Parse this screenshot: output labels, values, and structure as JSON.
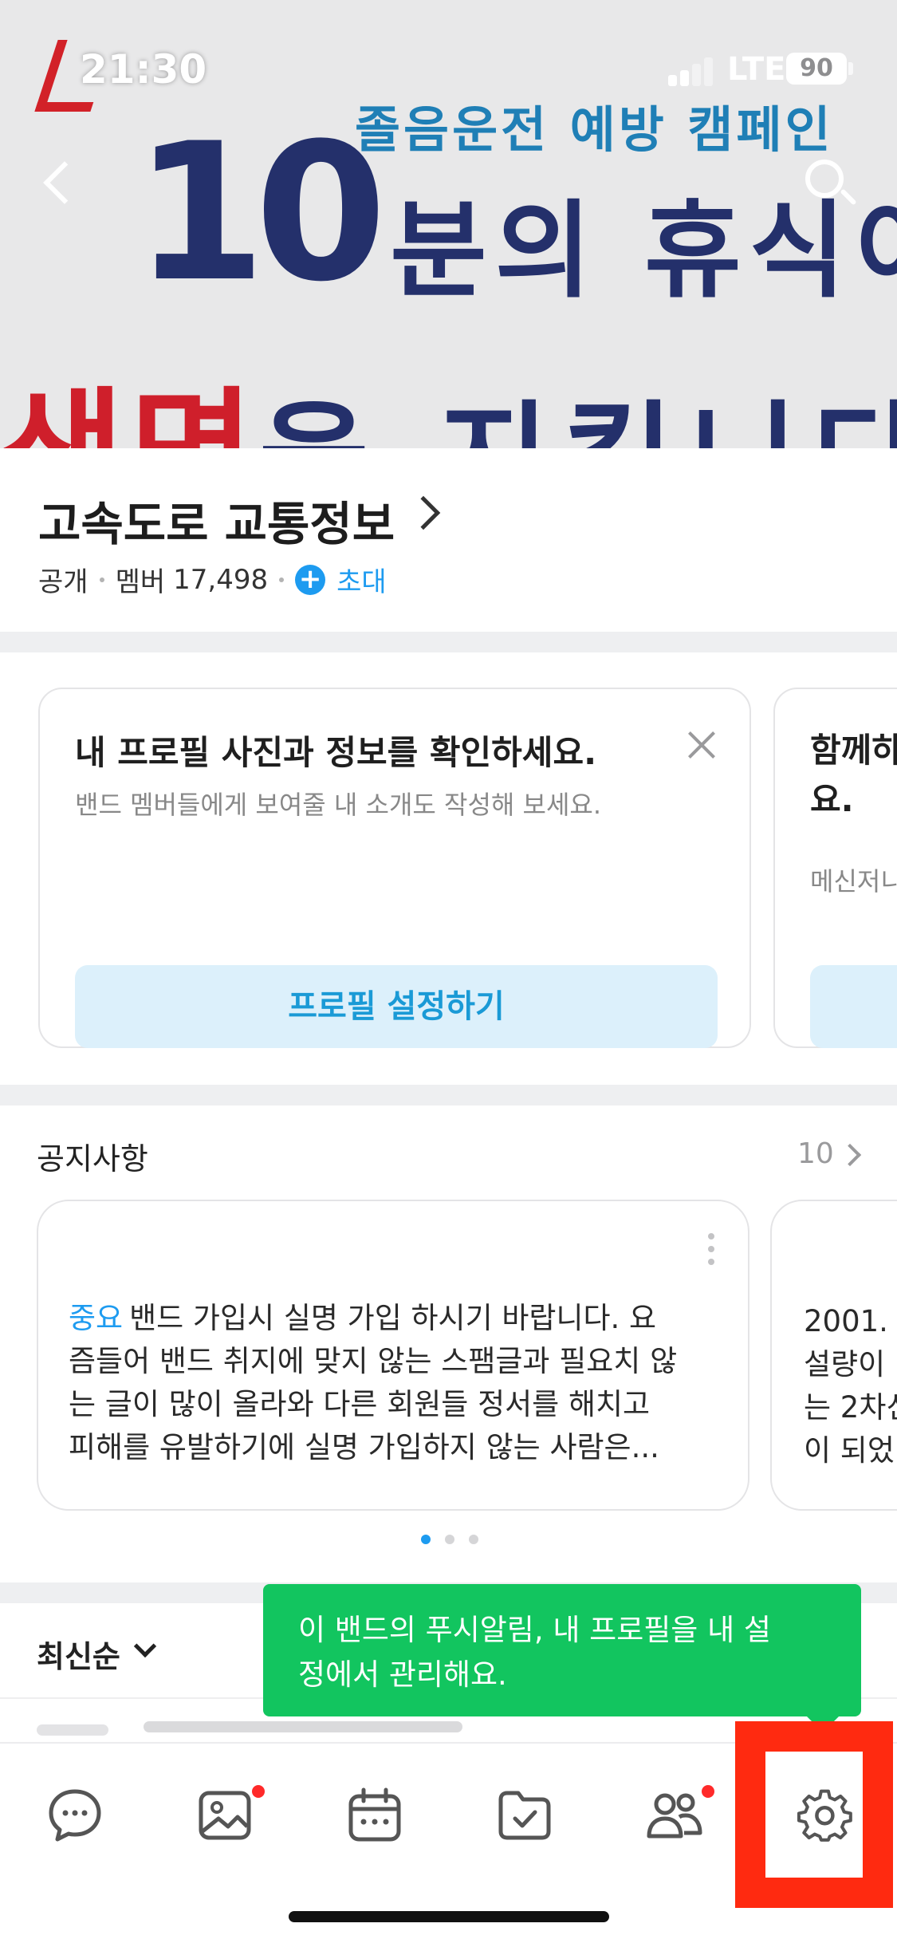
{
  "status_bar": {
    "time": "21:30",
    "network": "LTE",
    "battery": "90"
  },
  "banner": {
    "campaign": "졸음운전 예방 캠페인",
    "number": "10",
    "line2_text": "분의 휴식이",
    "line3_red": "생명",
    "line3_navy": "을 지킵니다"
  },
  "band": {
    "title": "고속도로 교통정보",
    "visibility": "공개",
    "members_label": "멤버",
    "member_count": "17,498",
    "invite_label": "초대"
  },
  "profile_cards": [
    {
      "title": "내 프로필 사진과 정보를 확인하세요.",
      "subtitle": "밴드 멤버들에게 보여줄 내 소개도 작성해 보세요.",
      "button": "프로필 설정하기"
    },
    {
      "title": "함께하 요.",
      "subtitle": "메신저니"
    }
  ],
  "notices": {
    "title": "공지사항",
    "count": "10",
    "items": [
      {
        "tag": "중요",
        "lines": [
          "밴드 가입시 실명 가입 하시기 바랍니다. 요",
          "즘들어 밴드 취지에 맞지 않는 스팸글과 필요치 않",
          "는 글이 많이 올라와 다른 회원들 정서를 해치고",
          "피해를 유발하기에 실명 가입하지 않는 사람은..."
        ]
      },
      {
        "lines": [
          "2001.",
          "설량이",
          "는 2차신",
          "이 되었"
        ]
      }
    ]
  },
  "sort": {
    "label": "최신순"
  },
  "tooltip": {
    "line1": "이 밴드의 푸시알림, 내 프로필을 내 설",
    "line2": "정에서 관리해요."
  },
  "tabs": [
    {
      "icon": "chat-icon",
      "badge": false
    },
    {
      "icon": "photo-icon",
      "badge": true
    },
    {
      "icon": "calendar-icon",
      "badge": false
    },
    {
      "icon": "folder-check-icon",
      "badge": false
    },
    {
      "icon": "members-icon",
      "badge": true
    },
    {
      "icon": "settings-gear-icon",
      "badge": false
    }
  ],
  "colors": {
    "accent": "#1d9bf0",
    "tooltip": "#12c55f",
    "highlight": "#ff2a10",
    "badge": "#ff2a2a",
    "banner_navy": "#24306b",
    "banner_red": "#cf1f2b"
  }
}
